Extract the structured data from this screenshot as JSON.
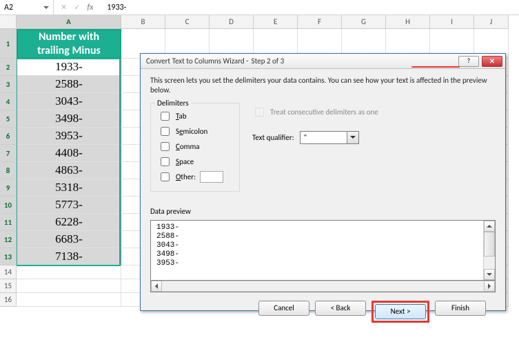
{
  "namebox": {
    "ref": "A2"
  },
  "formula_bar": {
    "value": "1933-"
  },
  "colA_header": {
    "line1": "Number with",
    "line2": "trailing Minus"
  },
  "col_letters": [
    "A",
    "B",
    "C",
    "D",
    "E",
    "F",
    "G",
    "H",
    "I",
    "J"
  ],
  "row_numbers": [
    "1",
    "2",
    "3",
    "4",
    "5",
    "6",
    "7",
    "8",
    "9",
    "10",
    "11",
    "12",
    "13",
    "14",
    "15",
    "16"
  ],
  "data_rows": [
    "1933-",
    "2588-",
    "3043-",
    "3498-",
    "3953-",
    "4408-",
    "4863-",
    "5318-",
    "5773-",
    "6228-",
    "6683-",
    "7138-"
  ],
  "dialog": {
    "title_prefix": "Convert Text to Columns Wizard - ",
    "title_step": "Step 2 of 3",
    "help": "?",
    "close": "✕",
    "intro": "This screen lets you set the delimiters your data contains.  You can see how your text is affected in the preview below.",
    "delimiters_legend": "Delimiters",
    "tab": "ab",
    "tab_pre": "T",
    "semicolon": "e",
    "semicolon_rest": "micolon",
    "semicolon_pre": "S",
    "comma": "omma",
    "comma_pre": "C",
    "space": "pace",
    "space_pre": "S",
    "other": "ther:",
    "other_pre": "O",
    "treat1": "reat consecutive delimiters as one",
    "treat_pre": "T",
    "qual_label_pre": "Text ",
    "qual_u": "q",
    "qual_rest": "ualifier:",
    "qual_value": "\"",
    "preview_label": "Data preview",
    "preview_lines": "1933-\n2588-\n3043-\n3498-\n3953-",
    "btn_cancel": "Cancel",
    "btn_back": "< Back",
    "btn_next": "Next >",
    "btn_finish": "Finish"
  }
}
